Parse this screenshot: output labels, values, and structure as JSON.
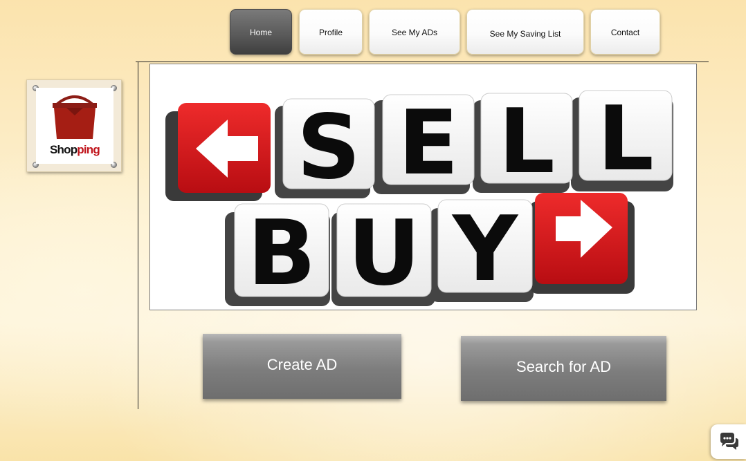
{
  "nav": {
    "items": [
      {
        "label": "Home",
        "active": true
      },
      {
        "label": "Profile",
        "active": false
      },
      {
        "label": "See My ADs",
        "active": false
      },
      {
        "label": "See My Saving List",
        "active": false
      },
      {
        "label": "Contact",
        "active": false
      }
    ]
  },
  "logo": {
    "text_part1": "Shop",
    "text_part2": "ping",
    "icon": "shopping-bag-icon"
  },
  "banner": {
    "row1": [
      "S",
      "E",
      "L",
      "L"
    ],
    "row2": [
      "B",
      "U",
      "Y"
    ],
    "left_arrow_icon": "arrow-left-icon",
    "right_arrow_icon": "arrow-right-icon"
  },
  "actions": {
    "create_label": "Create AD",
    "search_label": "Search for AD"
  },
  "chat": {
    "icon": "chat-bubbles-icon"
  },
  "colors": {
    "accent_red": "#d8141b",
    "button_gray": "#7d7d7d",
    "nav_active": "#555555"
  }
}
